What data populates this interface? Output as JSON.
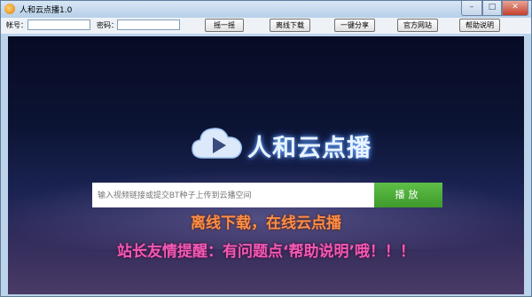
{
  "window": {
    "title": "人和云点播1.0",
    "controls": {
      "minimize": "–",
      "maximize": "□",
      "close": "✕"
    }
  },
  "toolbar": {
    "account_label": "帐号：",
    "account_value": "",
    "password_label": "密码：",
    "password_value": "",
    "buttons": [
      "摇一摇",
      "离线下载",
      "一键分享",
      "官方网站",
      "帮助说明"
    ]
  },
  "stage": {
    "logo_icon": "cloud-play-icon",
    "logo_text": "人和云点播",
    "url_placeholder": "输入视频链接或提交BT种子上传到云播空间",
    "play_label": "播放",
    "slogan": "离线下载，在线云点播",
    "reminder": "站长友情提醒：有问题点‘帮助说明’哦！！！"
  },
  "colors": {
    "play_button": "#4caf3a",
    "slogan": "#ff8f46",
    "reminder": "#f25ab8",
    "title_bar": "#c6d9ee"
  }
}
